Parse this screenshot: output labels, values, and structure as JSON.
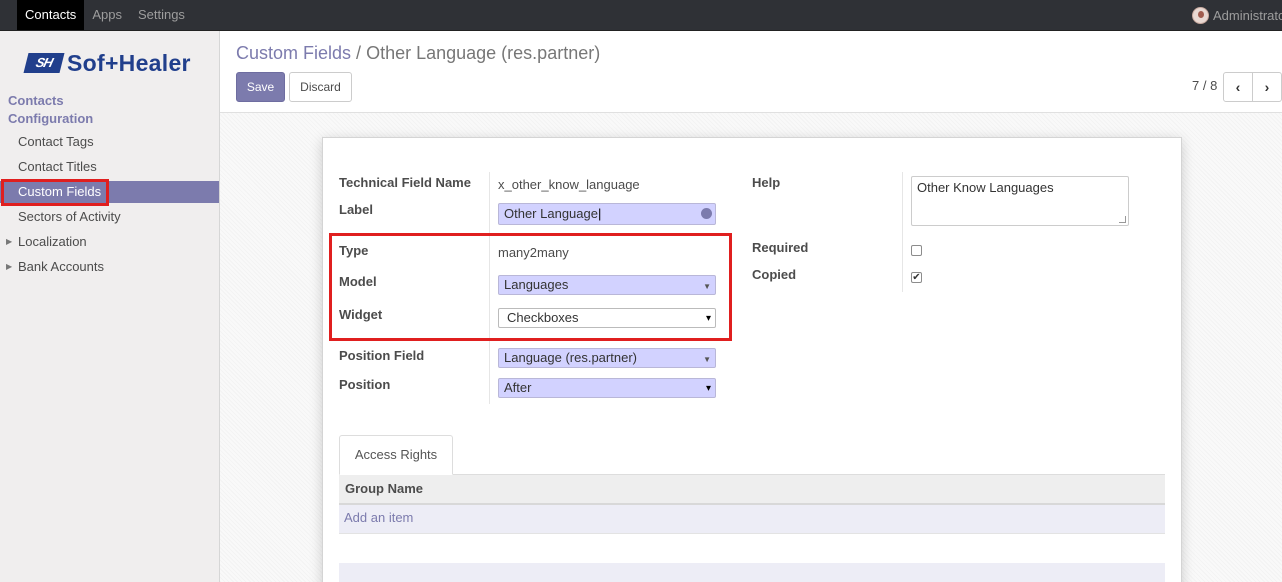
{
  "topbar": {
    "menu": [
      "Contacts",
      "Apps",
      "Settings"
    ],
    "user": "Administrator"
  },
  "sidebar": {
    "logo": {
      "mark": "SH",
      "word": "Sof+Healer"
    },
    "section_titles": [
      "Contacts",
      "Configuration"
    ],
    "items": [
      {
        "label": "Contact Tags"
      },
      {
        "label": "Contact Titles"
      },
      {
        "label": "Custom Fields",
        "active": true
      },
      {
        "label": "Sectors of Activity"
      },
      {
        "label": "Localization",
        "expandable": true
      },
      {
        "label": "Bank Accounts",
        "expandable": true
      }
    ]
  },
  "breadcrumb": {
    "parent": "Custom Fields",
    "separator": "/",
    "current": "Other Language (res.partner)"
  },
  "buttons": {
    "save": "Save",
    "discard": "Discard"
  },
  "pager": {
    "value": "7 / 8",
    "prev_icon": "chevron-left-icon",
    "next_icon": "chevron-right-icon"
  },
  "form": {
    "technical_field_name": {
      "label": "Technical Field Name",
      "value": "x_other_know_language"
    },
    "field_label": {
      "label": "Label",
      "value": "Other Language"
    },
    "type": {
      "label": "Type",
      "value": "many2many"
    },
    "model": {
      "label": "Model",
      "value": "Languages"
    },
    "widget": {
      "label": "Widget",
      "value": "Checkboxes"
    },
    "position_field": {
      "label": "Position Field",
      "value": "Language (res.partner)"
    },
    "position": {
      "label": "Position",
      "value": "After"
    },
    "help": {
      "label": "Help",
      "value": "Other Know Languages"
    },
    "required": {
      "label": "Required",
      "checked": false
    },
    "copied": {
      "label": "Copied",
      "checked": true
    }
  },
  "notebook": {
    "tab": "Access Rights",
    "column": "Group Name",
    "add_item": "Add an item"
  },
  "colors": {
    "accent": "#7c7bad",
    "highlight": "#e01f1f",
    "input_bg": "#d2d2ff"
  }
}
